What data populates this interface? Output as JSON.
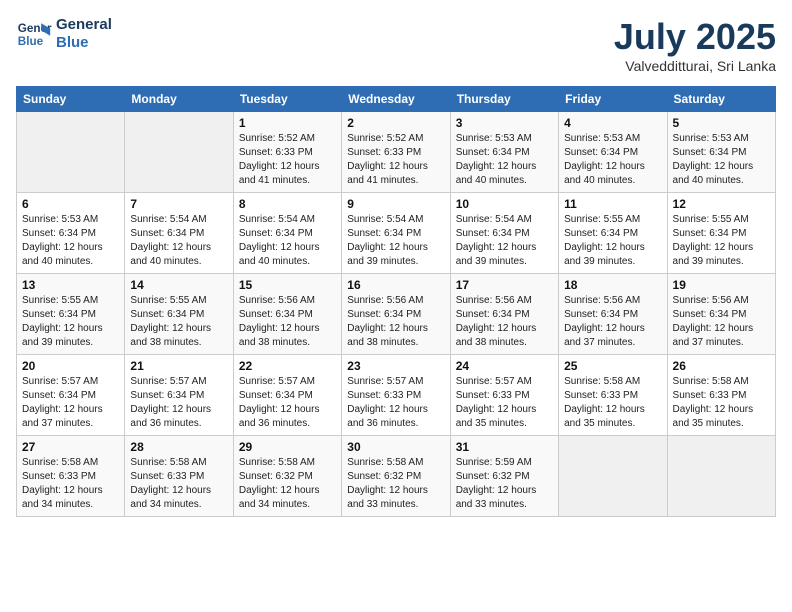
{
  "header": {
    "logo_line1": "General",
    "logo_line2": "Blue",
    "month": "July 2025",
    "location": "Valvedditturai, Sri Lanka"
  },
  "weekdays": [
    "Sunday",
    "Monday",
    "Tuesday",
    "Wednesday",
    "Thursday",
    "Friday",
    "Saturday"
  ],
  "weeks": [
    [
      {
        "day": "",
        "info": ""
      },
      {
        "day": "",
        "info": ""
      },
      {
        "day": "1",
        "info": "Sunrise: 5:52 AM\nSunset: 6:33 PM\nDaylight: 12 hours\nand 41 minutes."
      },
      {
        "day": "2",
        "info": "Sunrise: 5:52 AM\nSunset: 6:33 PM\nDaylight: 12 hours\nand 41 minutes."
      },
      {
        "day": "3",
        "info": "Sunrise: 5:53 AM\nSunset: 6:34 PM\nDaylight: 12 hours\nand 40 minutes."
      },
      {
        "day": "4",
        "info": "Sunrise: 5:53 AM\nSunset: 6:34 PM\nDaylight: 12 hours\nand 40 minutes."
      },
      {
        "day": "5",
        "info": "Sunrise: 5:53 AM\nSunset: 6:34 PM\nDaylight: 12 hours\nand 40 minutes."
      }
    ],
    [
      {
        "day": "6",
        "info": "Sunrise: 5:53 AM\nSunset: 6:34 PM\nDaylight: 12 hours\nand 40 minutes."
      },
      {
        "day": "7",
        "info": "Sunrise: 5:54 AM\nSunset: 6:34 PM\nDaylight: 12 hours\nand 40 minutes."
      },
      {
        "day": "8",
        "info": "Sunrise: 5:54 AM\nSunset: 6:34 PM\nDaylight: 12 hours\nand 40 minutes."
      },
      {
        "day": "9",
        "info": "Sunrise: 5:54 AM\nSunset: 6:34 PM\nDaylight: 12 hours\nand 39 minutes."
      },
      {
        "day": "10",
        "info": "Sunrise: 5:54 AM\nSunset: 6:34 PM\nDaylight: 12 hours\nand 39 minutes."
      },
      {
        "day": "11",
        "info": "Sunrise: 5:55 AM\nSunset: 6:34 PM\nDaylight: 12 hours\nand 39 minutes."
      },
      {
        "day": "12",
        "info": "Sunrise: 5:55 AM\nSunset: 6:34 PM\nDaylight: 12 hours\nand 39 minutes."
      }
    ],
    [
      {
        "day": "13",
        "info": "Sunrise: 5:55 AM\nSunset: 6:34 PM\nDaylight: 12 hours\nand 39 minutes."
      },
      {
        "day": "14",
        "info": "Sunrise: 5:55 AM\nSunset: 6:34 PM\nDaylight: 12 hours\nand 38 minutes."
      },
      {
        "day": "15",
        "info": "Sunrise: 5:56 AM\nSunset: 6:34 PM\nDaylight: 12 hours\nand 38 minutes."
      },
      {
        "day": "16",
        "info": "Sunrise: 5:56 AM\nSunset: 6:34 PM\nDaylight: 12 hours\nand 38 minutes."
      },
      {
        "day": "17",
        "info": "Sunrise: 5:56 AM\nSunset: 6:34 PM\nDaylight: 12 hours\nand 38 minutes."
      },
      {
        "day": "18",
        "info": "Sunrise: 5:56 AM\nSunset: 6:34 PM\nDaylight: 12 hours\nand 37 minutes."
      },
      {
        "day": "19",
        "info": "Sunrise: 5:56 AM\nSunset: 6:34 PM\nDaylight: 12 hours\nand 37 minutes."
      }
    ],
    [
      {
        "day": "20",
        "info": "Sunrise: 5:57 AM\nSunset: 6:34 PM\nDaylight: 12 hours\nand 37 minutes."
      },
      {
        "day": "21",
        "info": "Sunrise: 5:57 AM\nSunset: 6:34 PM\nDaylight: 12 hours\nand 36 minutes."
      },
      {
        "day": "22",
        "info": "Sunrise: 5:57 AM\nSunset: 6:34 PM\nDaylight: 12 hours\nand 36 minutes."
      },
      {
        "day": "23",
        "info": "Sunrise: 5:57 AM\nSunset: 6:33 PM\nDaylight: 12 hours\nand 36 minutes."
      },
      {
        "day": "24",
        "info": "Sunrise: 5:57 AM\nSunset: 6:33 PM\nDaylight: 12 hours\nand 35 minutes."
      },
      {
        "day": "25",
        "info": "Sunrise: 5:58 AM\nSunset: 6:33 PM\nDaylight: 12 hours\nand 35 minutes."
      },
      {
        "day": "26",
        "info": "Sunrise: 5:58 AM\nSunset: 6:33 PM\nDaylight: 12 hours\nand 35 minutes."
      }
    ],
    [
      {
        "day": "27",
        "info": "Sunrise: 5:58 AM\nSunset: 6:33 PM\nDaylight: 12 hours\nand 34 minutes."
      },
      {
        "day": "28",
        "info": "Sunrise: 5:58 AM\nSunset: 6:33 PM\nDaylight: 12 hours\nand 34 minutes."
      },
      {
        "day": "29",
        "info": "Sunrise: 5:58 AM\nSunset: 6:32 PM\nDaylight: 12 hours\nand 34 minutes."
      },
      {
        "day": "30",
        "info": "Sunrise: 5:58 AM\nSunset: 6:32 PM\nDaylight: 12 hours\nand 33 minutes."
      },
      {
        "day": "31",
        "info": "Sunrise: 5:59 AM\nSunset: 6:32 PM\nDaylight: 12 hours\nand 33 minutes."
      },
      {
        "day": "",
        "info": ""
      },
      {
        "day": "",
        "info": ""
      }
    ]
  ]
}
